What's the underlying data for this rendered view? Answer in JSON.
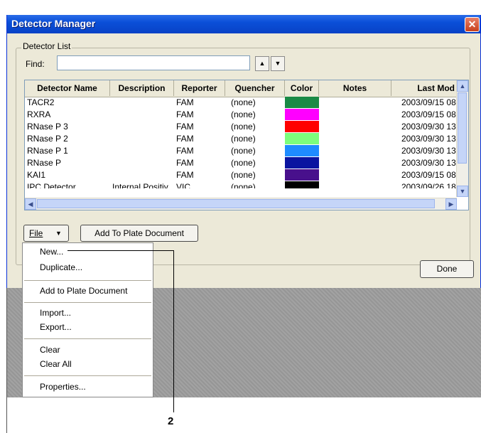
{
  "window": {
    "title": "Detector Manager",
    "close_glyph": "✕"
  },
  "group": {
    "label": "Detector List"
  },
  "find": {
    "label": "Find:",
    "value": "",
    "up_glyph": "▲",
    "down_glyph": "▼"
  },
  "table": {
    "columns": [
      "Detector Name",
      "Description",
      "Reporter",
      "Quencher",
      "Color",
      "Notes",
      "Last Mod"
    ],
    "rows": [
      {
        "name": "TACR2",
        "description": "",
        "reporter": "FAM",
        "quencher": "(none)",
        "color": "#1a8a46",
        "notes": "",
        "last_mod": "2003/09/15 08:"
      },
      {
        "name": "RXRA",
        "description": "",
        "reporter": "FAM",
        "quencher": "(none)",
        "color": "#ff00ff",
        "notes": "",
        "last_mod": "2003/09/15 08:"
      },
      {
        "name": "RNase P 3",
        "description": "",
        "reporter": "FAM",
        "quencher": "(none)",
        "color": "#ff0000",
        "notes": "",
        "last_mod": "2003/09/30 13:"
      },
      {
        "name": "RNase P 2",
        "description": "",
        "reporter": "FAM",
        "quencher": "(none)",
        "color": "#7cff7c",
        "notes": "",
        "last_mod": "2003/09/30 13:"
      },
      {
        "name": "RNase P 1",
        "description": "",
        "reporter": "FAM",
        "quencher": "(none)",
        "color": "#1e8cff",
        "notes": "",
        "last_mod": "2003/09/30 13:"
      },
      {
        "name": "RNase P",
        "description": "",
        "reporter": "FAM",
        "quencher": "(none)",
        "color": "#0a14a0",
        "notes": "",
        "last_mod": "2003/09/30 13:"
      },
      {
        "name": "KAI1",
        "description": "",
        "reporter": "FAM",
        "quencher": "(none)",
        "color": "#48108c",
        "notes": "",
        "last_mod": "2003/09/15 08:"
      },
      {
        "name": "IPC Detector",
        "description": "Internal Positiv",
        "reporter": "VIC",
        "quencher": "(none)",
        "color": "#000000",
        "notes": "",
        "last_mod": "2003/09/26 18:"
      }
    ]
  },
  "toolbar": {
    "file_label": "File",
    "file_arrow": "▼",
    "add_label": "Add To Plate Document"
  },
  "done_label": "Done",
  "menu": {
    "items": [
      "New...",
      "Duplicate...",
      "Add to Plate Document",
      "Import...",
      "Export...",
      "Clear",
      "Clear All",
      "Properties..."
    ]
  },
  "callout": {
    "number": "2"
  },
  "scroll": {
    "up": "▲",
    "down": "▼",
    "left": "◀",
    "right": "▶"
  }
}
